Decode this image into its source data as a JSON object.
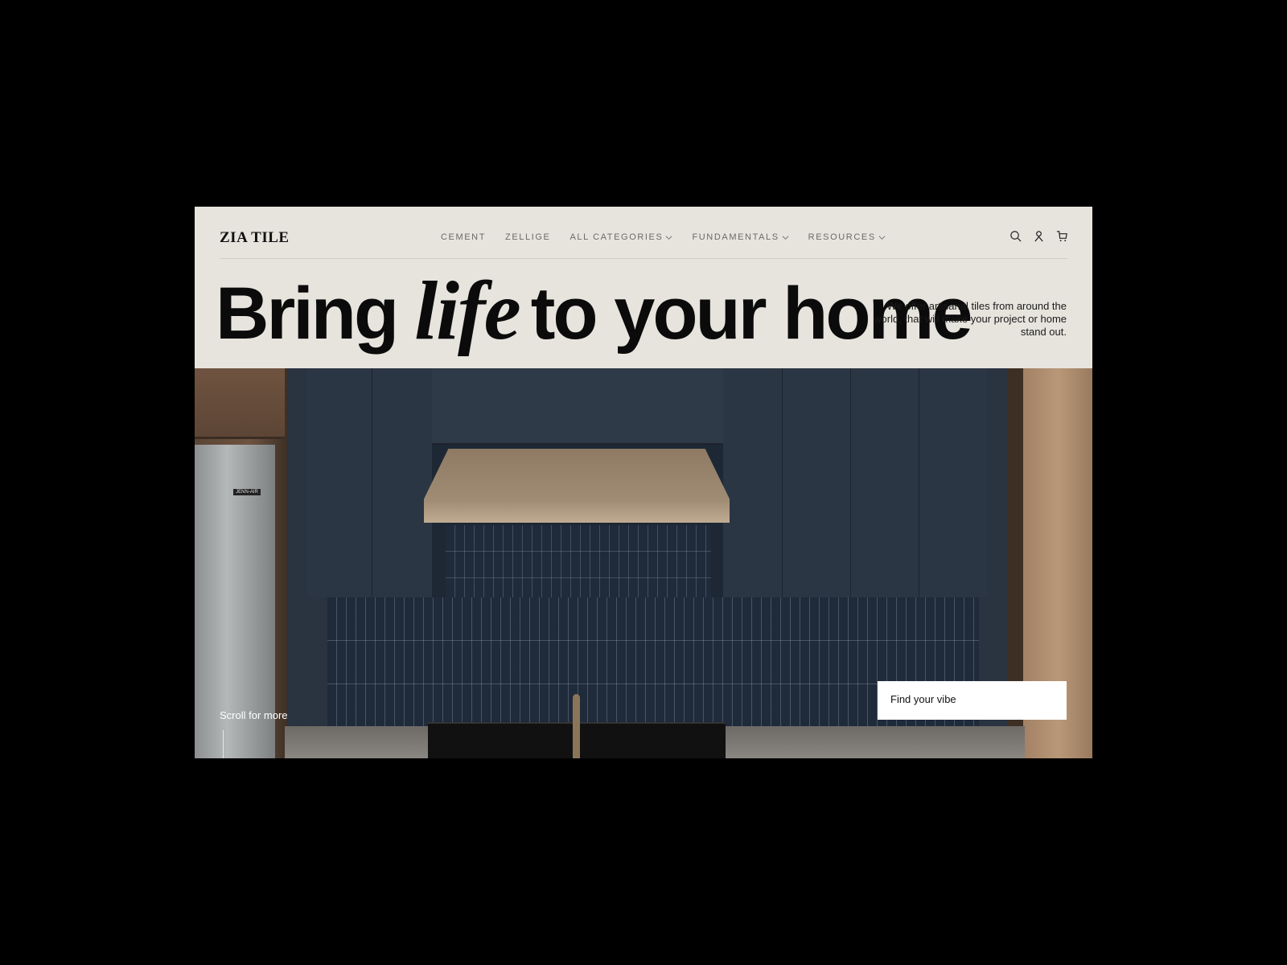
{
  "brand": {
    "logo": "ZIA TILE"
  },
  "nav": {
    "items": [
      {
        "label": "CEMENT",
        "dropdown": false
      },
      {
        "label": "ZELLIGE",
        "dropdown": false
      },
      {
        "label": "ALL CATEGORIES",
        "dropdown": true
      },
      {
        "label": "FUNDAMENTALS",
        "dropdown": true
      },
      {
        "label": "RESOURCES",
        "dropdown": true
      }
    ]
  },
  "header_icons": [
    "search-icon",
    "account-icon",
    "cart-icon"
  ],
  "hero": {
    "headline_before": "Bring",
    "headline_italic": "life",
    "headline_after": "to your home",
    "blurb": "We offer artisanal tiles from around the world, that will make your project or home stand out.",
    "scroll_label": "Scroll for more",
    "cta_label": "Find your vibe",
    "appliance_badge": "JENN-AIR"
  },
  "colors": {
    "background": "#e6e4dd",
    "text": "#0b0b0b",
    "page_bg": "#000000"
  }
}
